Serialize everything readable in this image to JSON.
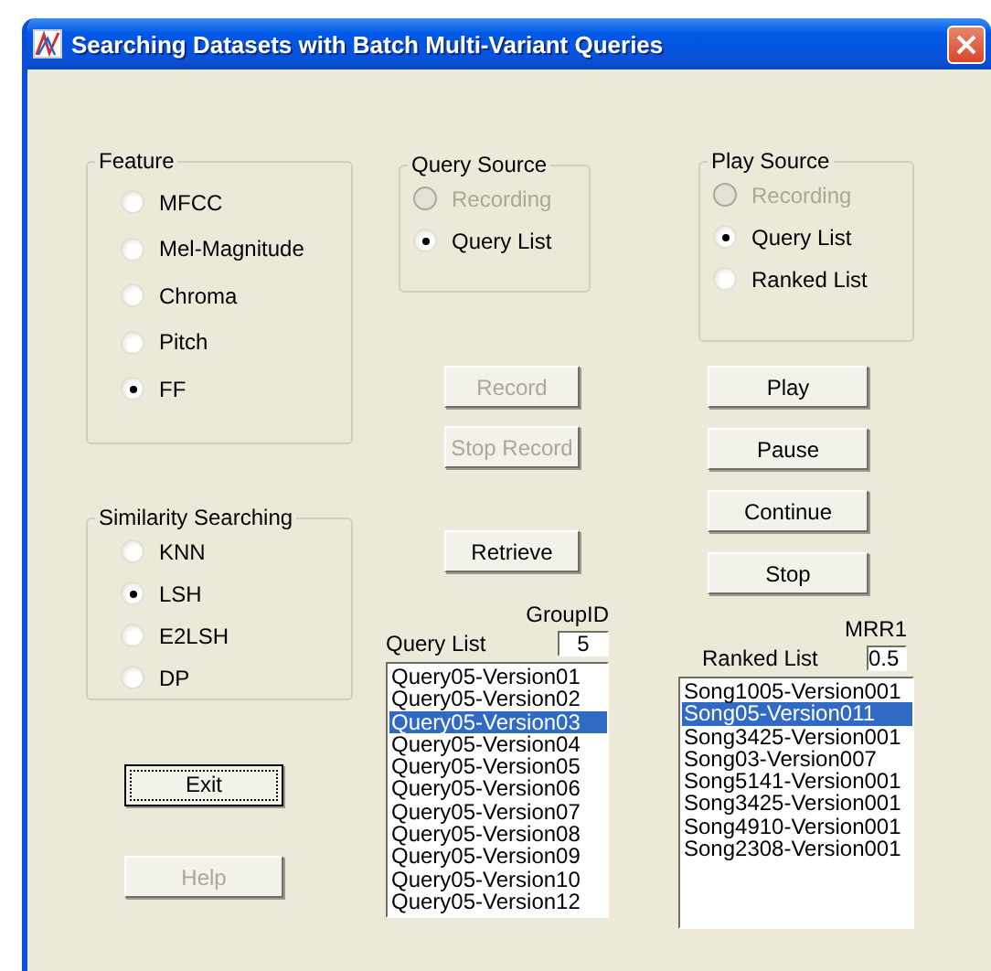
{
  "window": {
    "title": "Searching Datasets with Batch Multi-Variant Queries"
  },
  "feature": {
    "label": "Feature",
    "options": [
      {
        "label": "MFCC",
        "selected": false,
        "disabled": false
      },
      {
        "label": "Mel-Magnitude",
        "selected": false,
        "disabled": false
      },
      {
        "label": "Chroma",
        "selected": false,
        "disabled": false
      },
      {
        "label": "Pitch",
        "selected": false,
        "disabled": false
      },
      {
        "label": "FF",
        "selected": true,
        "disabled": false
      }
    ]
  },
  "similarity": {
    "label": "Similarity Searching",
    "options": [
      {
        "label": "KNN",
        "selected": false,
        "disabled": false
      },
      {
        "label": "LSH",
        "selected": true,
        "disabled": false
      },
      {
        "label": "E2LSH",
        "selected": false,
        "disabled": false
      },
      {
        "label": "DP",
        "selected": false,
        "disabled": false
      }
    ]
  },
  "query_source": {
    "label": "Query Source",
    "options": [
      {
        "label": "Recording",
        "selected": false,
        "disabled": true
      },
      {
        "label": "Query List",
        "selected": true,
        "disabled": false
      }
    ]
  },
  "play_source": {
    "label": "Play Source",
    "options": [
      {
        "label": "Recording",
        "selected": false,
        "disabled": true
      },
      {
        "label": "Query List",
        "selected": true,
        "disabled": false
      },
      {
        "label": "Ranked List",
        "selected": false,
        "disabled": false
      }
    ]
  },
  "left_buttons": [
    {
      "label": "Exit",
      "disabled": false,
      "focused": true
    },
    {
      "label": "Help",
      "disabled": true,
      "focused": false
    }
  ],
  "middle_buttons": [
    {
      "label": "Record",
      "disabled": true
    },
    {
      "label": "Stop Record",
      "disabled": true
    },
    {
      "label": "Retrieve",
      "disabled": false
    }
  ],
  "play_buttons": [
    {
      "label": "Play",
      "disabled": false
    },
    {
      "label": "Pause",
      "disabled": false
    },
    {
      "label": "Continue",
      "disabled": false
    },
    {
      "label": "Stop",
      "disabled": false
    }
  ],
  "query_list": {
    "label": "Query List",
    "field_label": "GroupID",
    "field_value": "5",
    "items": [
      {
        "text": "Query05-Version01",
        "selected": false
      },
      {
        "text": "Query05-Version02",
        "selected": false
      },
      {
        "text": "Query05-Version03",
        "selected": true
      },
      {
        "text": "Query05-Version04",
        "selected": false
      },
      {
        "text": "Query05-Version05",
        "selected": false
      },
      {
        "text": "Query05-Version06",
        "selected": false
      },
      {
        "text": "Query05-Version07",
        "selected": false
      },
      {
        "text": "Query05-Version08",
        "selected": false
      },
      {
        "text": "Query05-Version09",
        "selected": false
      },
      {
        "text": "Query05-Version10",
        "selected": false
      },
      {
        "text": "Query05-Version12",
        "selected": false
      }
    ]
  },
  "ranked_list": {
    "label": "Ranked List",
    "field_label": "MRR1",
    "field_value": "0.5",
    "items": [
      {
        "text": "Song1005-Version001",
        "selected": false
      },
      {
        "text": "Song05-Version011",
        "selected": true
      },
      {
        "text": "Song3425-Version001",
        "selected": false
      },
      {
        "text": "Song03-Version007",
        "selected": false
      },
      {
        "text": "Song5141-Version001",
        "selected": false
      },
      {
        "text": "Song3425-Version001",
        "selected": false
      },
      {
        "text": "Song4910-Version001",
        "selected": false
      },
      {
        "text": "Song2308-Version001",
        "selected": false
      }
    ]
  }
}
